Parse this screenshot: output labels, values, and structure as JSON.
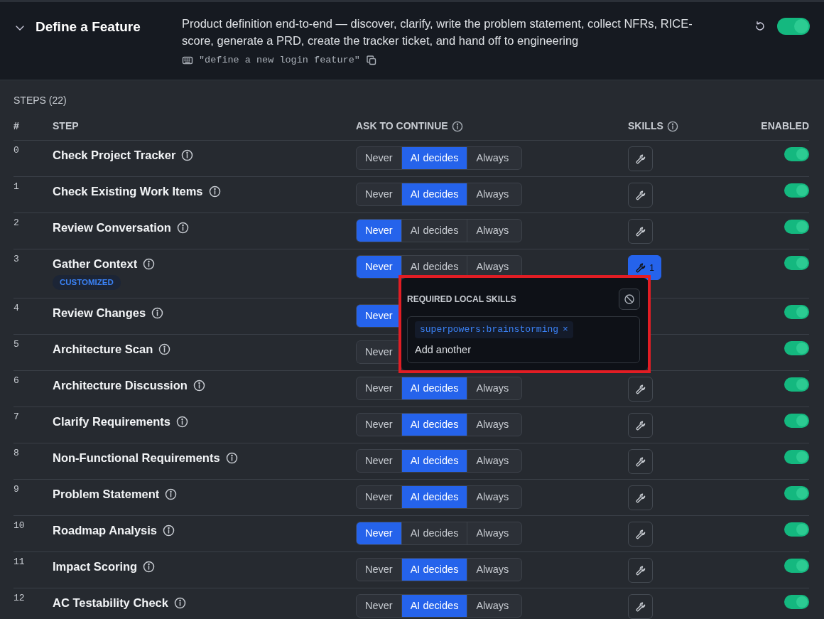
{
  "header": {
    "expanded": true,
    "title": "Define a Feature",
    "description": "Product definition end-to-end — discover, clarify, write the problem statement, collect NFRs, RICE-score, generate a PRD, create the tracker ticket, and hand off to engineering",
    "example": "\"define a new login feature\"",
    "enabled": true
  },
  "steps_label": "STEPS (22)",
  "columns": [
    {
      "label": "#"
    },
    {
      "label": "STEP"
    },
    {
      "label": "ASK TO CONTINUE",
      "info": true
    },
    {
      "label": "SKILLS",
      "info": true
    },
    {
      "label": "ENABLED"
    }
  ],
  "rows": [
    {
      "index": "0",
      "name": "Check Project Tracker",
      "options": [
        {
          "label": "Never",
          "selected": false
        },
        {
          "label": "AI decides",
          "selected": true
        },
        {
          "label": "Always",
          "selected": false
        }
      ],
      "skills": {
        "active": false
      },
      "enabled": true
    },
    {
      "index": "1",
      "name": "Check Existing Work Items",
      "options": [
        {
          "label": "Never",
          "selected": false
        },
        {
          "label": "AI decides",
          "selected": true
        },
        {
          "label": "Always",
          "selected": false
        }
      ],
      "skills": {
        "active": false
      },
      "enabled": true
    },
    {
      "index": "2",
      "name": "Review Conversation",
      "options": [
        {
          "label": "Never",
          "selected": true
        },
        {
          "label": "AI decides",
          "selected": false
        },
        {
          "label": "Always",
          "selected": false
        }
      ],
      "skills": {
        "active": false
      },
      "enabled": true
    },
    {
      "index": "3",
      "name": "Gather Context",
      "badge": "CUSTOMIZED",
      "options": [
        {
          "label": "Never",
          "selected": true
        },
        {
          "label": "AI decides",
          "selected": false
        },
        {
          "label": "Always",
          "selected": false
        }
      ],
      "skills": {
        "active": true,
        "count": "1"
      },
      "enabled": true
    },
    {
      "index": "4",
      "name": "Review Changes",
      "options": [
        {
          "label": "Never",
          "selected": true
        }
      ],
      "enabled": true
    },
    {
      "index": "5",
      "name": "Architecture Scan",
      "options": [
        {
          "label": "Never",
          "selected": false
        }
      ],
      "enabled": true
    },
    {
      "index": "6",
      "name": "Architecture Discussion",
      "options": [
        {
          "label": "Never",
          "selected": false
        },
        {
          "label": "AI decides",
          "selected": true
        },
        {
          "label": "Always",
          "selected": false
        }
      ],
      "skills": {
        "active": false
      },
      "enabled": true
    },
    {
      "index": "7",
      "name": "Clarify Requirements",
      "options": [
        {
          "label": "Never",
          "selected": false
        },
        {
          "label": "AI decides",
          "selected": true
        },
        {
          "label": "Always",
          "selected": false
        }
      ],
      "skills": {
        "active": false
      },
      "enabled": true
    },
    {
      "index": "8",
      "name": "Non-Functional Requirements",
      "options": [
        {
          "label": "Never",
          "selected": false
        },
        {
          "label": "AI decides",
          "selected": true
        },
        {
          "label": "Always",
          "selected": false
        }
      ],
      "skills": {
        "active": false
      },
      "enabled": true
    },
    {
      "index": "9",
      "name": "Problem Statement",
      "options": [
        {
          "label": "Never",
          "selected": false
        },
        {
          "label": "AI decides",
          "selected": true
        },
        {
          "label": "Always",
          "selected": false
        }
      ],
      "skills": {
        "active": false
      },
      "enabled": true
    },
    {
      "index": "10",
      "name": "Roadmap Analysis",
      "options": [
        {
          "label": "Never",
          "selected": true
        },
        {
          "label": "AI decides",
          "selected": false
        },
        {
          "label": "Always",
          "selected": false
        }
      ],
      "skills": {
        "active": false
      },
      "enabled": true
    },
    {
      "index": "11",
      "name": "Impact Scoring",
      "options": [
        {
          "label": "Never",
          "selected": false
        },
        {
          "label": "AI decides",
          "selected": true
        },
        {
          "label": "Always",
          "selected": false
        }
      ],
      "skills": {
        "active": false
      },
      "enabled": true
    },
    {
      "index": "12",
      "name": "AC Testability Check",
      "options": [
        {
          "label": "Never",
          "selected": false
        },
        {
          "label": "AI decides",
          "selected": true
        },
        {
          "label": "Always",
          "selected": false
        }
      ],
      "skills": {
        "active": false
      },
      "enabled": true
    }
  ],
  "popover": {
    "title": "REQUIRED LOCAL SKILLS",
    "tags": [
      {
        "label": "superpowers:brainstorming",
        "remove": "×"
      }
    ],
    "placeholder": "Add another"
  }
}
